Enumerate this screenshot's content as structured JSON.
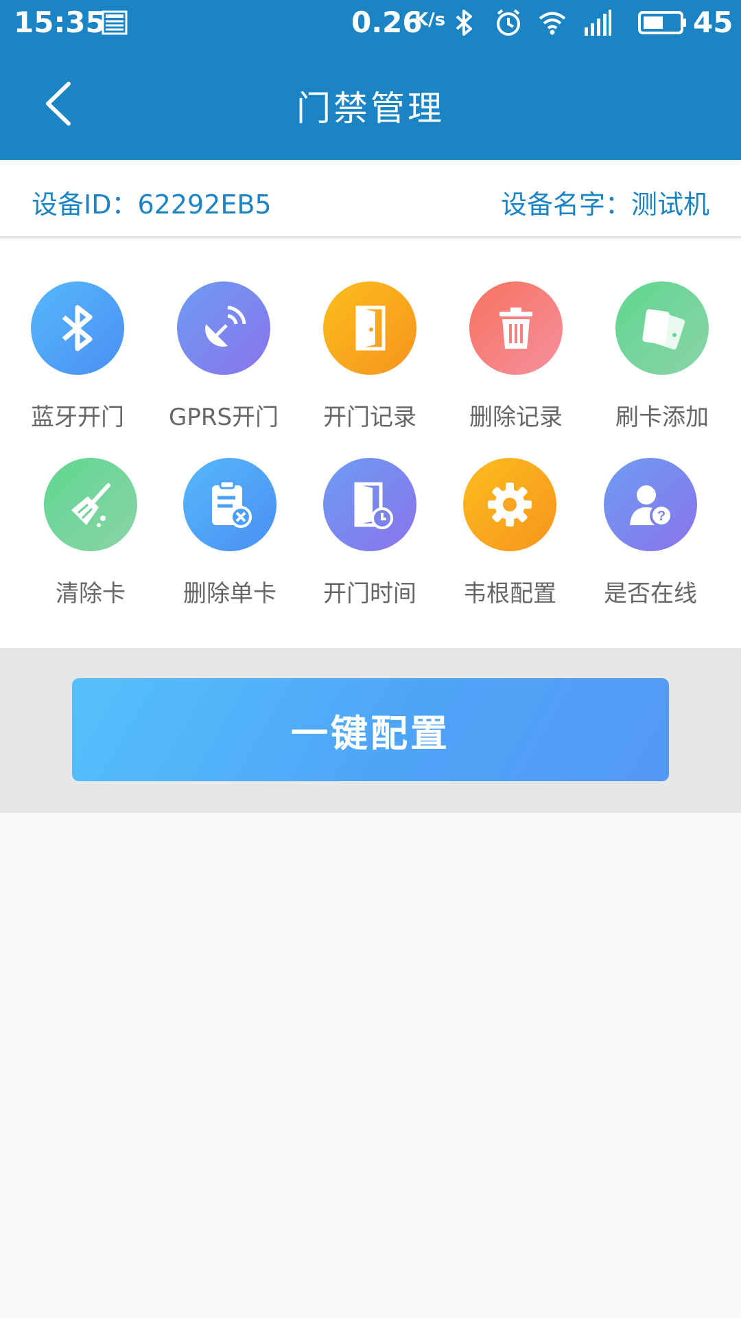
{
  "status_bar": {
    "time": "15:35",
    "speed": "0.26",
    "speed_unit": "K/s",
    "battery": "45",
    "icons": [
      "news-icon",
      "bluetooth-icon",
      "alarm-icon",
      "wifi-icon",
      "signal-4g-icon",
      "battery-icon"
    ]
  },
  "header": {
    "title": "门禁管理",
    "back_icon": "chevron-left-icon",
    "background": "#1a84c4"
  },
  "device": {
    "id_text": "设备ID：62292EB5",
    "name_text": "设备名字：测试机"
  },
  "grid": [
    {
      "label": "蓝牙开门",
      "icon": "bluetooth-icon",
      "color": "#4a9ff6"
    },
    {
      "label": "GPRS开门",
      "icon": "satellite-dish-icon",
      "color": "#7b83ec"
    },
    {
      "label": "开门记录",
      "icon": "door-icon",
      "color": "#f9a623"
    },
    {
      "label": "删除记录",
      "icon": "trash-icon",
      "color": "#f57f7b"
    },
    {
      "label": "刷卡添加",
      "icon": "cards-icon",
      "color": "#6dd29a"
    },
    {
      "label": "清除卡",
      "icon": "broom-icon",
      "color": "#6dd29a"
    },
    {
      "label": "删除单卡",
      "icon": "clipboard-delete-icon",
      "color": "#4a9ff6"
    },
    {
      "label": "开门时间",
      "icon": "door-clock-icon",
      "color": "#7b83ec"
    },
    {
      "label": "韦根配置",
      "icon": "gear-icon",
      "color": "#f9a623"
    },
    {
      "label": "是否在线",
      "icon": "user-question-icon",
      "color": "#7b83ec"
    }
  ],
  "actions": {
    "config_label": "一键配置"
  }
}
